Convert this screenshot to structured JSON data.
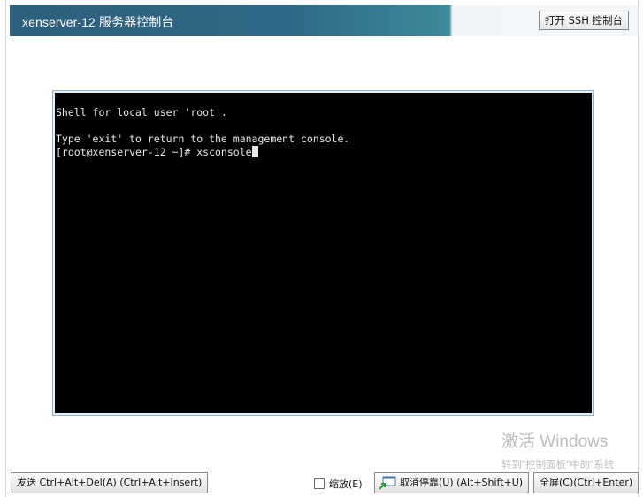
{
  "window": {
    "title": "xenserver-12 服务器控制台",
    "ssh_button": "打开 SSH 控制台"
  },
  "console": {
    "lines": [
      "Shell for local user 'root'.",
      "",
      "Type 'exit' to return to the management console.",
      "[root@xenserver-12 ~]# xsconsole"
    ]
  },
  "watermark": {
    "line1": "激活 Windows",
    "line2": "转到\"控制面板\"中的\"系统"
  },
  "toolbar": {
    "send_cad": "发送 Ctrl+Alt+Del(A) (Ctrl+Alt+Insert)",
    "scale_label": "缩放(E)",
    "undock": "取消停靠(U) (Alt+Shift+U)",
    "fullscreen": "全屏(C)(Ctrl+Enter)"
  },
  "icons": {
    "undock": "undock-window-icon"
  }
}
